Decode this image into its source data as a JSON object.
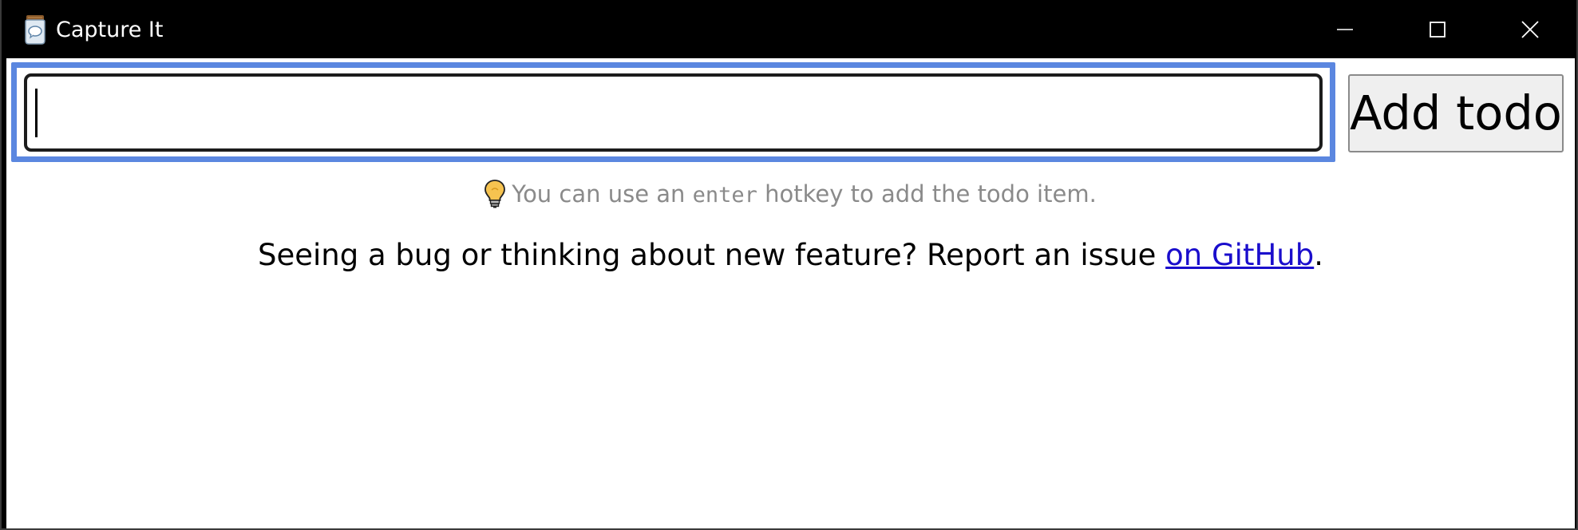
{
  "window": {
    "title": "Capture It",
    "icon": "jar-app-icon",
    "controls": {
      "minimize_icon": "minimize-icon",
      "maximize_icon": "maximize-icon",
      "close_icon": "close-icon"
    }
  },
  "todo_input": {
    "value": "",
    "placeholder": ""
  },
  "add_button": {
    "label": "Add todo"
  },
  "hint": {
    "icon": "lightbulb-icon",
    "prefix": "You can use an",
    "hotkey": "enter",
    "suffix": "hotkey to add the todo item."
  },
  "report": {
    "text": "Seeing a bug or thinking about new feature? Report an issue",
    "link_label": "on GitHub",
    "trailing": "."
  },
  "colors": {
    "titlebar": "#000000",
    "focus_ring": "#5b87e0",
    "link": "#1a0dcc",
    "hint_text": "#8a8a8a",
    "button_bg": "#efefef"
  }
}
